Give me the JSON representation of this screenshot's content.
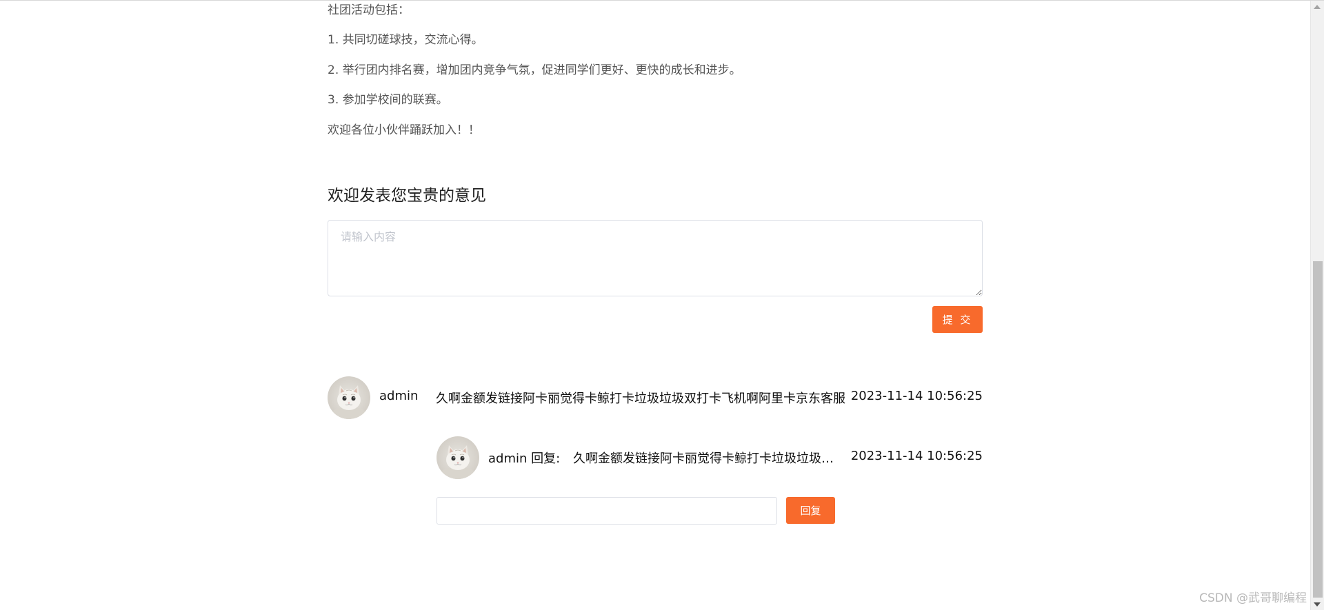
{
  "intro": {
    "lines": [
      "社团活动包括：",
      "1. 共同切磋球技，交流心得。",
      "2. 举行团内排名赛，增加团内竞争气氛，促进同学们更好、更快的成长和进步。",
      "3. 参加学校间的联赛。",
      "欢迎各位小伙伴踊跃加入！！"
    ]
  },
  "feedback": {
    "title": "欢迎发表您宝贵的意见",
    "placeholder": "请输入内容",
    "submit_label": "提 交"
  },
  "comments": [
    {
      "username": "admin",
      "text": "久啊金额发链接阿卡丽觉得卡鲸打卡垃圾垃圾双打卡飞机啊阿里卡京东客服",
      "time": "2023-11-14 10:56:25",
      "avatar": "cat-avatar",
      "replies": [
        {
          "username": "admin 回复:",
          "text": "久啊金额发链接阿卡丽觉得卡鲸打卡垃圾垃圾双打卡飞机",
          "time": "2023-11-14 10:56:25",
          "avatar": "cat-avatar"
        }
      ]
    }
  ],
  "reply": {
    "input_value": "",
    "button_label": "回复"
  },
  "watermark": "CSDN @武哥聊编程",
  "colors": {
    "accent": "#f86a2c",
    "border": "#dcdfe6",
    "placeholder": "#c0c4cc"
  }
}
